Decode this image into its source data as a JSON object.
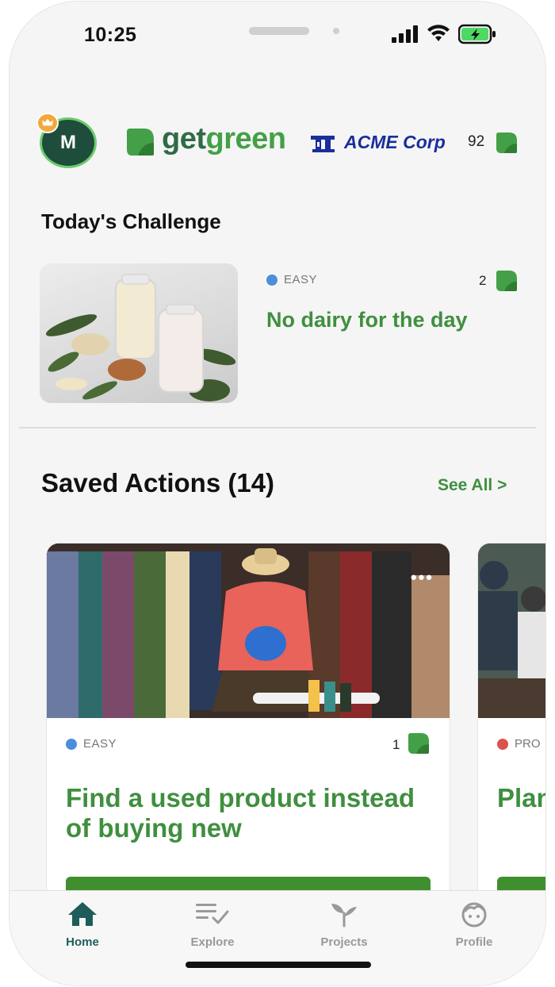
{
  "status_bar": {
    "time": "10:25",
    "icons": [
      "cellular-signal-icon",
      "wifi-icon",
      "battery-charging-icon"
    ]
  },
  "header": {
    "avatar_initial": "M",
    "avatar_badge_icon": "crown-icon",
    "logo": {
      "prefix": "get",
      "suffix": "green",
      "icon": "leaf-icon"
    },
    "partner": {
      "name": "ACME Corp",
      "icon": "acme-logo-icon"
    },
    "points": "92",
    "points_icon": "leaf-icon"
  },
  "today_challenge": {
    "heading": "Today's Challenge",
    "difficulty": "EASY",
    "points": "2",
    "title": "No dairy for the day",
    "image": "milk-bottles-photo"
  },
  "saved_actions": {
    "heading": "Saved Actions (14)",
    "see_all": "See All >",
    "cards": [
      {
        "difficulty": "EASY",
        "points": "1",
        "title": "Find a used product instead of buying new",
        "image": "thrift-store-clothes-photo",
        "more_icon": "more-horizontal-icon"
      },
      {
        "difficulty": "PRO",
        "title": "Plan a hom",
        "image": "hikers-outdoors-photo"
      }
    ]
  },
  "tabs": [
    {
      "label": "Home",
      "icon": "home-icon",
      "active": true
    },
    {
      "label": "Explore",
      "icon": "list-check-icon",
      "active": false
    },
    {
      "label": "Projects",
      "icon": "sprout-icon",
      "active": false
    },
    {
      "label": "Profile",
      "icon": "face-icon",
      "active": false
    }
  ],
  "colors": {
    "brand_green": "#3f8f3f",
    "brand_dark": "#1e4d3b",
    "acme_blue": "#1a2e9c",
    "easy_blue": "#4a90d9",
    "pro_red": "#d9534f",
    "active_tab": "#1f5c5c"
  }
}
